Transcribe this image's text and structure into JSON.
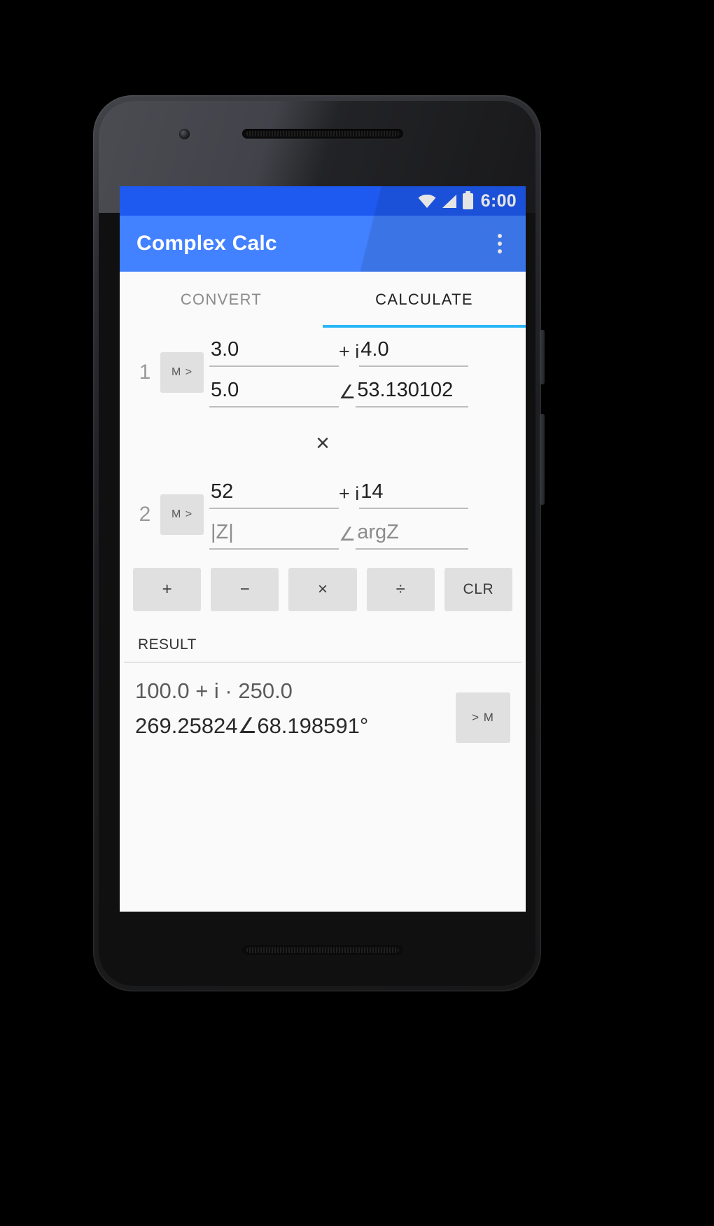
{
  "status_bar": {
    "time": "6:00",
    "icons": [
      "wifi-icon",
      "cell-signal-icon",
      "battery-icon"
    ]
  },
  "app_bar": {
    "title": "Complex Calc",
    "overflow_menu": "more-options"
  },
  "tabs": [
    {
      "label": "CONVERT",
      "active": false
    },
    {
      "label": "CALCULATE",
      "active": true
    }
  ],
  "theme": {
    "status_bar_blue": "#1e5af0",
    "app_bar_blue": "#4281ff",
    "tab_indicator_cyan": "#29b6f6",
    "key_gray": "#e0e0e0",
    "screen_bg": "#fafafa"
  },
  "operands": [
    {
      "index": "1",
      "memory_button": "M >",
      "rect_real": "3.0",
      "rect_imag_prefix": "+ i",
      "rect_imag": "4.0",
      "polar_mag": "5.0",
      "polar_angle_prefix": "∠",
      "polar_angle": "53.130102"
    },
    {
      "index": "2",
      "memory_button": "M >",
      "rect_real": "52",
      "rect_imag_prefix": "+ i",
      "rect_imag": "14",
      "polar_mag": "|Z|",
      "polar_angle_prefix": "∠",
      "polar_angle": "argZ"
    }
  ],
  "operator_symbol": "×",
  "keys": [
    {
      "label": "+",
      "name": "add"
    },
    {
      "label": "−",
      "name": "subtract"
    },
    {
      "label": "×",
      "name": "multiply"
    },
    {
      "label": "÷",
      "name": "divide"
    },
    {
      "label": "CLR",
      "name": "clear"
    }
  ],
  "result": {
    "label": "RESULT",
    "rectangular": "100.0 + i · 250.0",
    "polar": "269.25824∠68.198591°",
    "to_memory_button": "> M"
  }
}
